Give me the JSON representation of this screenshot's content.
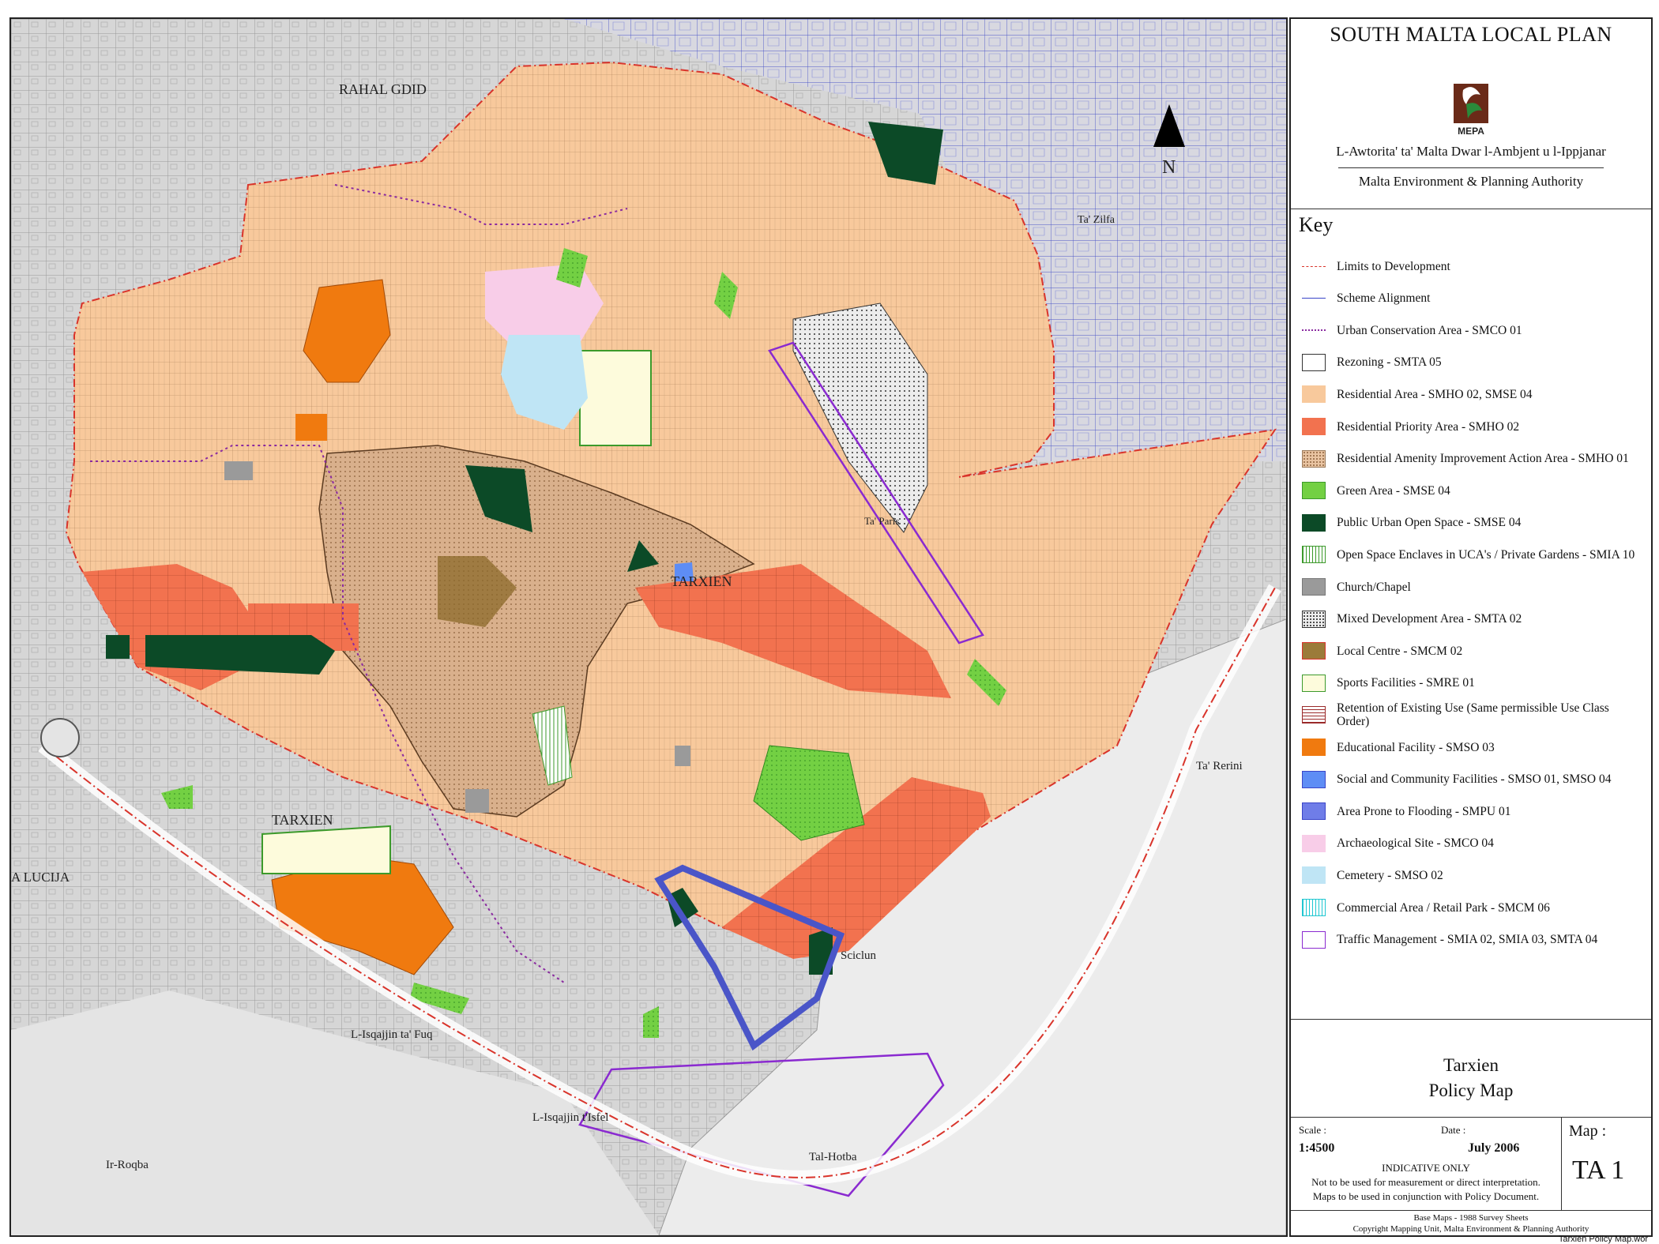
{
  "panel": {
    "title": "SOUTH MALTA LOCAL PLAN",
    "logo_text": "MEPA",
    "authority_maltese": "L-Awtorita' ta' Malta Dwar l-Ambjent u l-Ippjanar",
    "authority_english": "Malta Environment & Planning Authority",
    "key_title": "Key",
    "key_items": [
      {
        "label": "Limits to Development",
        "kind": "dashline",
        "color": "#d9342b"
      },
      {
        "label": "Scheme Alignment",
        "kind": "line",
        "color": "#3a45c8"
      },
      {
        "label": "Urban Conservation Area - SMCO 01",
        "kind": "dotline",
        "color": "#8a2aa0"
      },
      {
        "label": "Rezoning - SMTA 05",
        "kind": "box",
        "color": "#ffffff",
        "border": "#333333"
      },
      {
        "label": "Residential Area - SMHO 02, SMSE 04",
        "kind": "box",
        "color": "#f8c99c",
        "border": "#f8c99c"
      },
      {
        "label": "Residential Priority Area - SMHO 02",
        "kind": "box",
        "color": "#f2724f",
        "border": "#f2724f"
      },
      {
        "label": "Residential Amenity Improvement Action Area - SMHO 01",
        "kind": "hatch",
        "color": "#e9c4a2",
        "border": "#9a7a5a"
      },
      {
        "label": "Green Area - SMSE 04",
        "kind": "box",
        "color": "#73d043",
        "border": "#3c9a2b"
      },
      {
        "label": "Public Urban Open Space - SMSE 04",
        "kind": "box",
        "color": "#0c4a27",
        "border": "#0c4a27"
      },
      {
        "label": "Open Space Enclaves in UCA's / Private Gardens - SMIA 10",
        "kind": "stripes",
        "color": "#ffffff",
        "border": "#3c9a2b"
      },
      {
        "label": "Church/Chapel",
        "kind": "box",
        "color": "#9a9a9a",
        "border": "#777777"
      },
      {
        "label": "Mixed Development Area - SMTA 02",
        "kind": "dots",
        "color": "#eeeeee",
        "border": "#333333"
      },
      {
        "label": "Local Centre - SMCM 02",
        "kind": "box",
        "color": "#9b7b3a",
        "border": "#d9342b"
      },
      {
        "label": "Sports Facilities - SMRE 01",
        "kind": "box",
        "color": "#fdfbdc",
        "border": "#3c9a2b"
      },
      {
        "label": "Retention of Existing Use (Same permissible Use Class Order)",
        "kind": "hstripes",
        "color": "#ffffff",
        "border": "#9b2a2a"
      },
      {
        "label": "Educational Facility - SMSO 03",
        "kind": "box",
        "color": "#f07a0f",
        "border": "#f07a0f"
      },
      {
        "label": "Social and Community Facilities - SMSO 01, SMSO 04",
        "kind": "box",
        "color": "#5e8df5",
        "border": "#3a45c8"
      },
      {
        "label": "Area Prone to Flooding - SMPU 01",
        "kind": "box",
        "color": "#6f7de8",
        "border": "#3a45c8"
      },
      {
        "label": "Archaeological Site - SMCO 04",
        "kind": "box",
        "color": "#f8cde8",
        "border": "#f8cde8"
      },
      {
        "label": "Cemetery - SMSO 02",
        "kind": "box",
        "color": "#bfe5f5",
        "border": "#bfe5f5"
      },
      {
        "label": "Commercial Area / Retail Park - SMCM 06",
        "kind": "stripes",
        "color": "#ffffff",
        "border": "#1fc7d1"
      },
      {
        "label": "Traffic Management - SMIA 02, SMIA 03, SMTA 04",
        "kind": "box",
        "color": "#ffffff",
        "border": "#8a2ad0"
      }
    ],
    "map_title_1": "Tarxien",
    "map_title_2": "Policy Map",
    "scale_label": "Scale :",
    "scale_value": "1:4500",
    "date_label": "Date :",
    "date_value": "July 2006",
    "indicative": "INDICATIVE ONLY",
    "note_1": "Not to be used for measurement or direct interpretation.",
    "note_2": "Maps to be used in conjunction with Policy Document.",
    "map_label": "Map :",
    "map_number": "TA 1",
    "footer_1": "Base Maps - 1988 Survey Sheets",
    "footer_2": "Copyright Mapping Unit, Malta Environment & Planning Authority"
  },
  "map": {
    "north_label": "N",
    "place_labels": [
      "RAHAL GDID",
      "TARXIEN",
      "TARXIEN",
      "Sciclun",
      "Ta' Rerini",
      "Tal-Hotba",
      "Ir-Roqba",
      "L-Isqajjin t'Isfel",
      "L-Isqajjin ta' Fuq",
      "A LUCIJA",
      "Ta' Zilfa",
      "Ta' Paris"
    ]
  },
  "file_reference": "Tarxien Policy Map.wor"
}
